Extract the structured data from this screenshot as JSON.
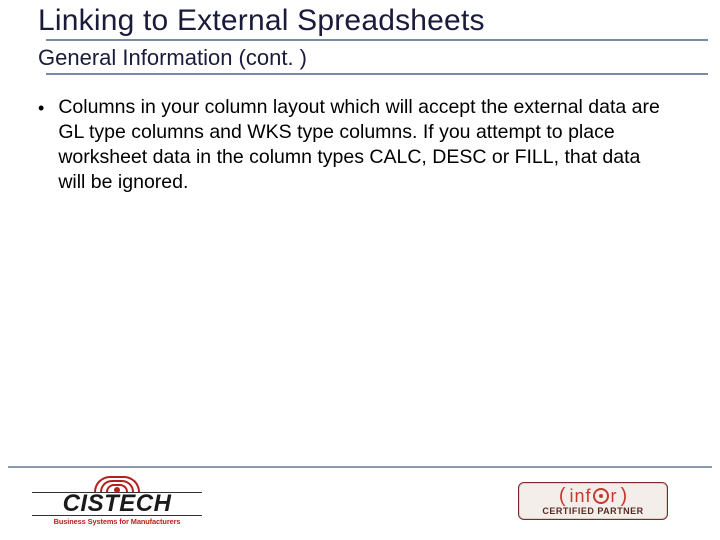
{
  "title": "Linking to External Spreadsheets",
  "subtitle": "General Information (cont. )",
  "bullets": [
    "Columns in your column layout which will accept the external data are GL type columns and WKS type columns.  If you attempt to place worksheet data in the column types CALC, DESC or FILL, that data will be ignored."
  ],
  "logos": {
    "cistech": {
      "word": "CISTECH",
      "tagline": "Business Systems for Manufacturers"
    },
    "infor": {
      "letters": [
        "i",
        "n",
        "f",
        "r"
      ],
      "sub": "CERTIFIED PARTNER"
    }
  }
}
